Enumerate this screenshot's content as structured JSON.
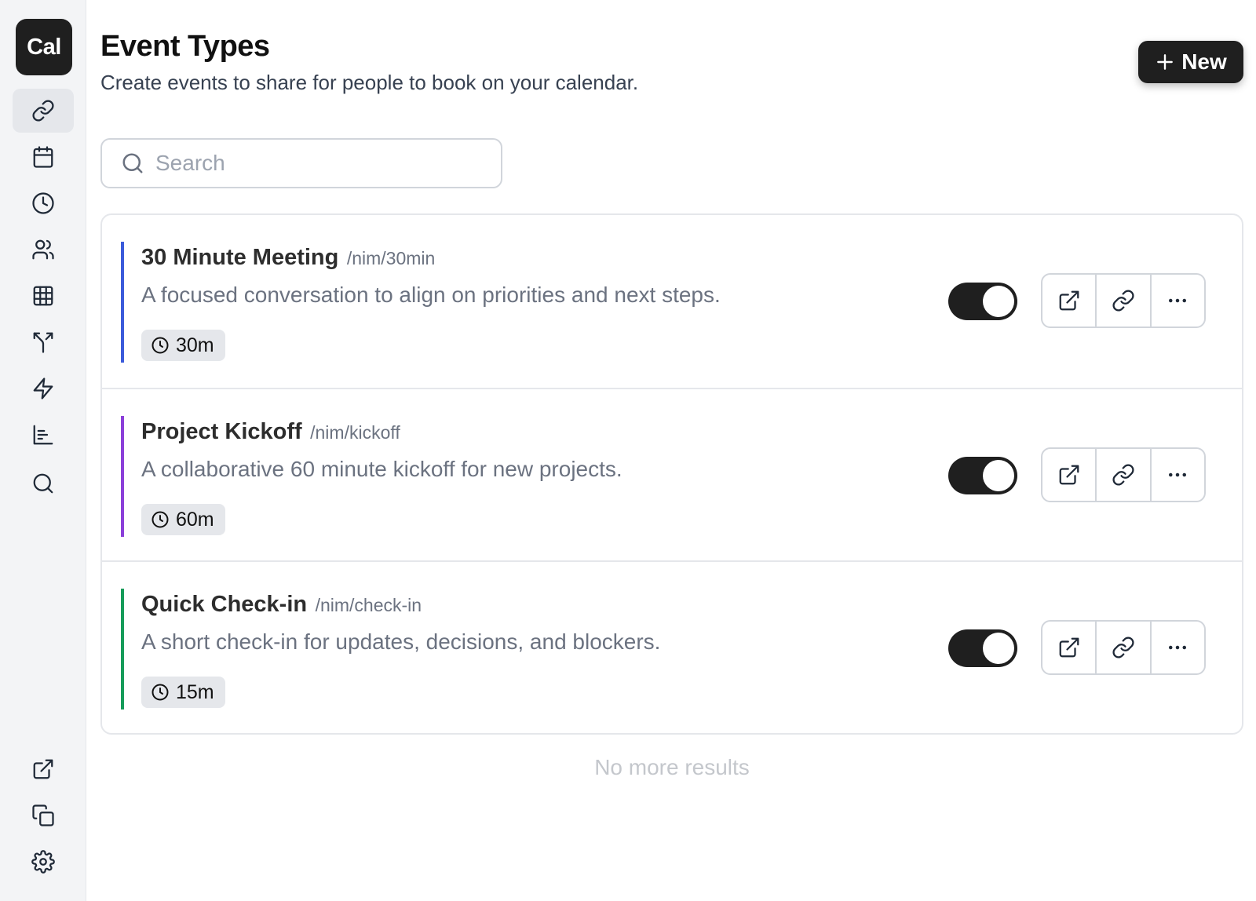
{
  "app": {
    "logo_text": "Cal"
  },
  "sidebar": {
    "nav_icons": [
      "link-icon",
      "calendar-icon",
      "clock-icon",
      "users-icon",
      "grid-icon",
      "routing-icon",
      "lightning-icon",
      "chart-icon",
      "search-icon"
    ],
    "bottom_icons": [
      "external-link-icon",
      "copy-icon",
      "gear-icon"
    ],
    "active": "link-icon"
  },
  "header": {
    "title": "Event Types",
    "subtitle": "Create events to share for people to book on your calendar.",
    "new_button": "New"
  },
  "search": {
    "placeholder": "Search",
    "value": ""
  },
  "events": [
    {
      "title": "30 Minute Meeting",
      "slug": "/nim/30min",
      "description": "A focused conversation to align on priorities and next steps.",
      "duration": "30m",
      "enabled": true,
      "accent_color": "#3b5bdb"
    },
    {
      "title": "Project Kickoff",
      "slug": "/nim/kickoff",
      "description": "A collaborative 60 minute kickoff for new projects.",
      "duration": "60m",
      "enabled": true,
      "accent_color": "#8b3fd9"
    },
    {
      "title": "Quick Check-in",
      "slug": "/nim/check-in",
      "description": "A short check-in for updates, decisions, and blockers.",
      "duration": "15m",
      "enabled": true,
      "accent_color": "#169c5a"
    }
  ],
  "footer_text": "No more results",
  "colors": {
    "primary": "#1f1f1f",
    "sidebar_bg": "#f3f4f6",
    "border": "#e5e7eb"
  }
}
